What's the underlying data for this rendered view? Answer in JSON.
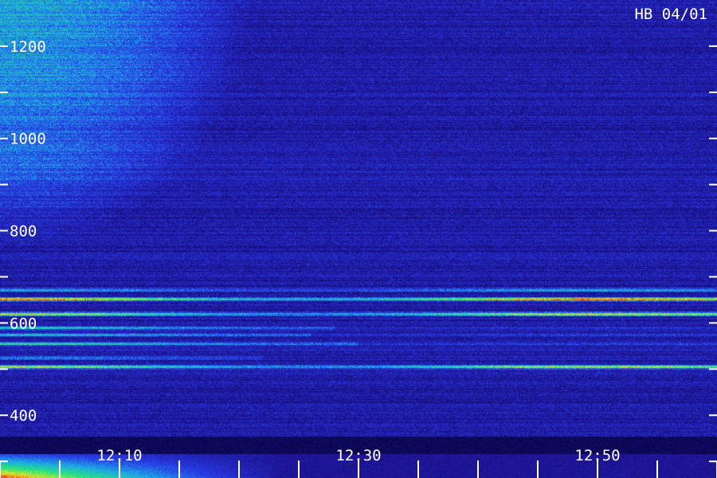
{
  "chart_data": {
    "type": "heatmap",
    "station_label": "HB 04/01",
    "y_axis": {
      "range": [
        264,
        1300
      ],
      "labels": [
        {
          "value": 400,
          "text": "400"
        },
        {
          "value": 600,
          "text": "600"
        },
        {
          "value": 800,
          "text": "800"
        },
        {
          "value": 1000,
          "text": "1000"
        },
        {
          "value": 1200,
          "text": "1200"
        }
      ],
      "minor_tick_values": [
        300,
        400,
        500,
        600,
        700,
        800,
        900,
        1000,
        1100,
        1200
      ]
    },
    "x_axis": {
      "range_minutes": [
        0,
        60
      ],
      "labels": [
        {
          "minute": 10,
          "text": "12:10"
        },
        {
          "minute": 30,
          "text": "12:30"
        },
        {
          "minute": 50,
          "text": "12:50"
        }
      ],
      "tick_minutes": [
        0,
        5,
        10,
        15,
        20,
        25,
        30,
        35,
        40,
        45,
        50,
        55,
        60
      ]
    },
    "emission_lines": [
      {
        "value": 672,
        "intensity": 0.55,
        "end_minute": 60
      },
      {
        "value": 652,
        "intensity": 1.0,
        "end_minute": 60
      },
      {
        "value": 620,
        "intensity": 0.95,
        "end_minute": 60
      },
      {
        "value": 590,
        "intensity": 0.6,
        "end_minute": 28
      },
      {
        "value": 575,
        "intensity": 0.5,
        "end_minute": 26
      },
      {
        "value": 555,
        "intensity": 0.6,
        "end_minute": 30
      },
      {
        "value": 525,
        "intensity": 0.45,
        "end_minute": 22
      },
      {
        "value": 505,
        "intensity": 0.9,
        "end_minute": 60
      }
    ]
  }
}
